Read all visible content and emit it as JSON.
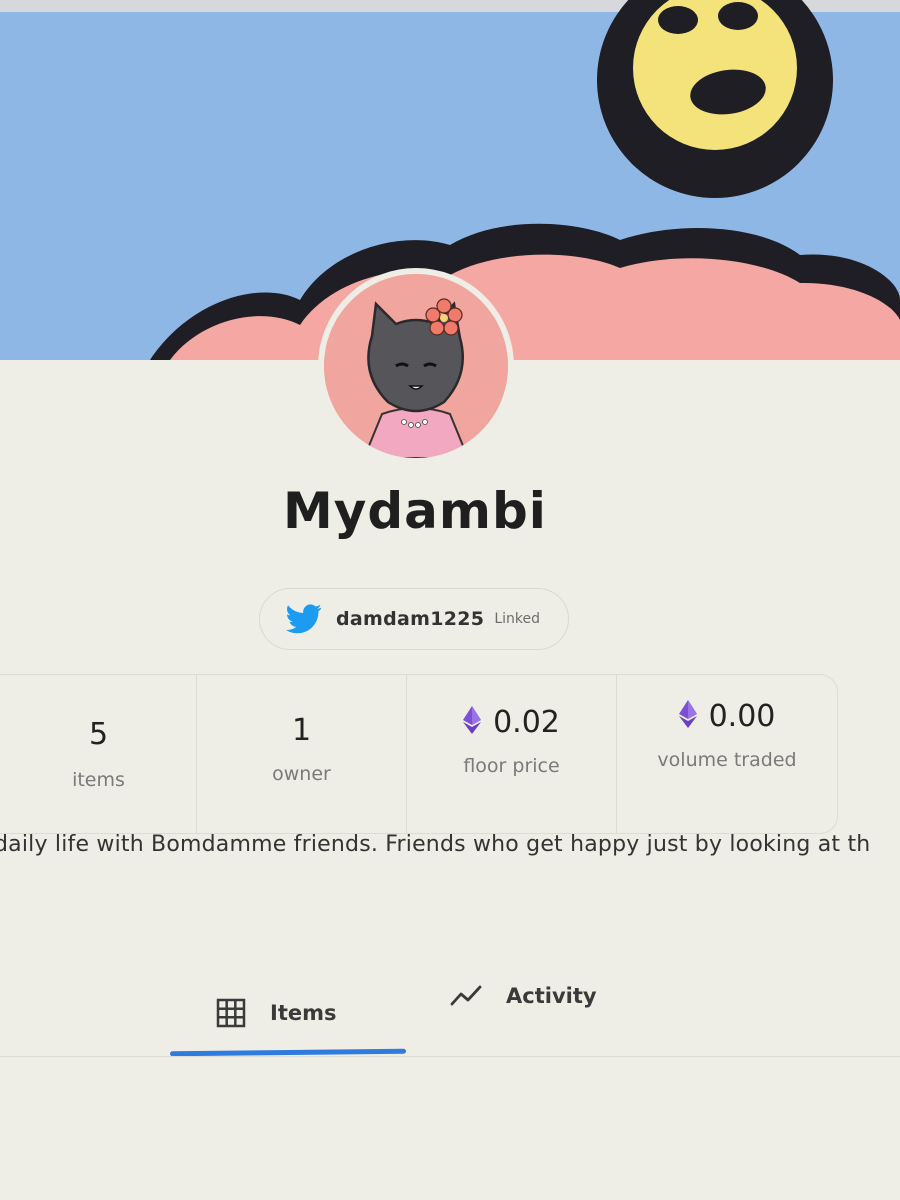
{
  "collection": {
    "name": "Mydambi",
    "twitter": {
      "icon": "twitter-bird-icon",
      "handle": "damdam1225",
      "status": "Linked"
    },
    "stats": [
      {
        "value": "5",
        "label": "items",
        "icon": null
      },
      {
        "value": "1",
        "label": "owner",
        "icon": null
      },
      {
        "value": "0.02",
        "label": "floor price",
        "icon": "ethereum-icon"
      },
      {
        "value": "0.00",
        "label": "volume traded",
        "icon": "ethereum-icon"
      }
    ],
    "description": "daily life with Bomdamme friends. Friends who get happy just by looking at th"
  },
  "tabs": [
    {
      "label": "Items",
      "icon": "grid-icon",
      "active": true
    },
    {
      "label": "Activity",
      "icon": "activity-chart-icon",
      "active": false
    }
  ],
  "colors": {
    "page_background": "#eeeee6",
    "banner_sky": "#8fb7e6",
    "banner_cloud_pink": "#f4a7a3",
    "banner_outline": "#1e1e24",
    "emoji_yellow": "#f3e37a",
    "twitter_blue": "#1d9bf0",
    "ethereum_purple": "#7b4fd6",
    "tab_indicator": "#2f7be0"
  }
}
